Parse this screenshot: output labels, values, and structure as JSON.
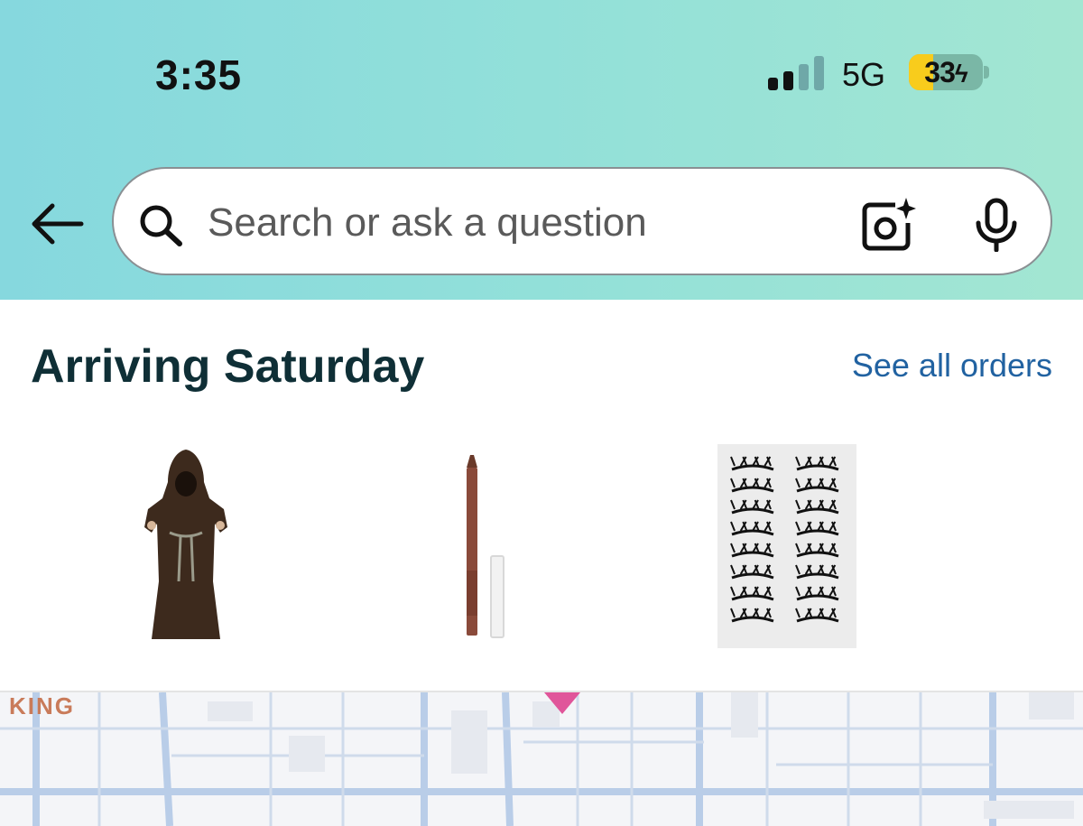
{
  "status_bar": {
    "time": "3:35",
    "network": "5G",
    "battery_percent": "33",
    "battery_level": 0.33,
    "battery_charging": true,
    "signal_bars_active": 2,
    "signal_bars_total": 4
  },
  "search": {
    "placeholder": "Search or ask a question",
    "icons": [
      "back-arrow-icon",
      "search-icon",
      "camera-sparkle-icon",
      "microphone-icon"
    ]
  },
  "arrivals": {
    "title": "Arriving Saturday",
    "see_all_label": "See all orders",
    "products": [
      {
        "name": "monk-robe-costume",
        "icon": "hooded-robe-image"
      },
      {
        "name": "lip-liner-pencil",
        "icon": "pencil-image"
      },
      {
        "name": "false-eyelashes-pack",
        "icon": "eyelashes-image"
      }
    ]
  },
  "map": {
    "label": "KING"
  },
  "colors": {
    "header_gradient_start": "#86d8de",
    "header_gradient_end": "#a3e6d2",
    "title": "#0f2f36",
    "link": "#2162a1",
    "battery_fill": "#f8cc1c",
    "map_pin": "#e0559a"
  }
}
